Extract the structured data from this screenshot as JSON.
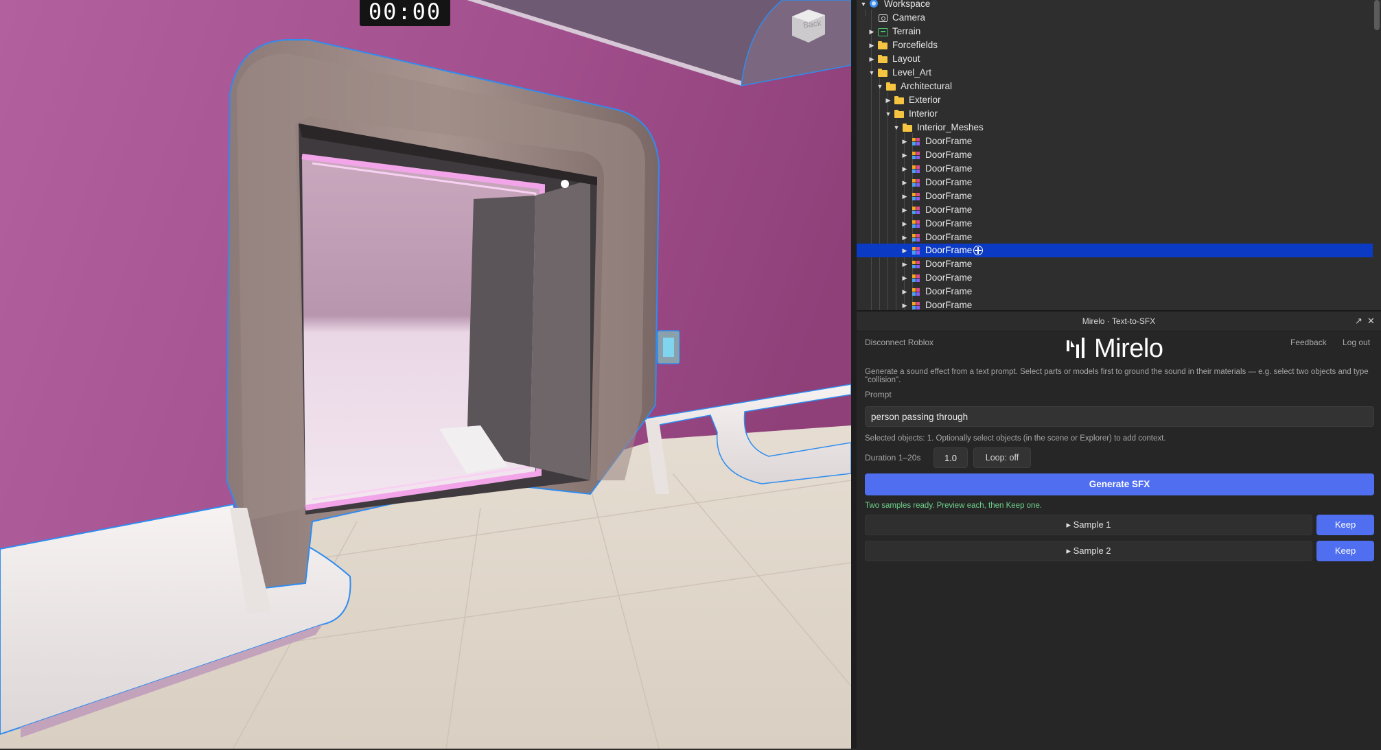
{
  "viewport": {
    "timer": "00:00",
    "view_cube_label": "Back"
  },
  "explorer": {
    "items": [
      {
        "label": "Workspace",
        "icon": "workspace-icon",
        "expanded": true
      },
      {
        "label": "Camera",
        "icon": "camera-icon"
      },
      {
        "label": "Terrain",
        "icon": "terrain-icon"
      },
      {
        "label": "Forcefields",
        "icon": "folder-icon",
        "expanded": false
      },
      {
        "label": "Layout",
        "icon": "folder-icon",
        "expanded": false
      },
      {
        "label": "Level_Art",
        "icon": "folder-icon",
        "expanded": true
      },
      {
        "label": "Architectural",
        "icon": "folder-icon",
        "expanded": true
      },
      {
        "label": "Exterior",
        "icon": "folder-icon",
        "expanded": false
      },
      {
        "label": "Interior",
        "icon": "folder-icon",
        "expanded": true
      },
      {
        "label": "Interior_Meshes",
        "icon": "folder-icon",
        "expanded": true
      },
      {
        "label": "DoorFrame",
        "icon": "model-icon",
        "expanded": false
      },
      {
        "label": "DoorFrame",
        "icon": "model-icon",
        "expanded": false
      },
      {
        "label": "DoorFrame",
        "icon": "model-icon",
        "expanded": false
      },
      {
        "label": "DoorFrame",
        "icon": "model-icon",
        "expanded": false
      },
      {
        "label": "DoorFrame",
        "icon": "model-icon",
        "expanded": false
      },
      {
        "label": "DoorFrame",
        "icon": "model-icon",
        "expanded": false
      },
      {
        "label": "DoorFrame",
        "icon": "model-icon",
        "expanded": false
      },
      {
        "label": "DoorFrame",
        "icon": "model-icon",
        "expanded": false
      },
      {
        "label": "DoorFrame",
        "icon": "model-icon",
        "expanded": false,
        "selected": true
      },
      {
        "label": "DoorFrame",
        "icon": "model-icon",
        "expanded": false
      },
      {
        "label": "DoorFrame",
        "icon": "model-icon",
        "expanded": false
      },
      {
        "label": "DoorFrame",
        "icon": "model-icon",
        "expanded": false
      },
      {
        "label": "DoorFrame",
        "icon": "model-icon",
        "expanded": false
      }
    ]
  },
  "plugin": {
    "title": "Mirelo · Text-to-SFX",
    "disconnect_label": "Disconnect Roblox",
    "feedback_label": "Feedback",
    "logout_label": "Log out",
    "logo_text": "Mirelo",
    "description": "Generate a sound effect from a text prompt. Select parts or models first to ground the sound in their materials — e.g. select two objects and type \"collision\".",
    "prompt_label": "Prompt",
    "prompt_value": "person passing through",
    "selected_objects": "Selected objects: 1. Optionally select objects (in the scene or Explorer) to add context.",
    "duration_label": "Duration 1–20s",
    "duration_value": "1.0",
    "loop_label": "Loop: off",
    "generate_label": "Generate SFX",
    "status": "Two samples ready. Preview each, then Keep one.",
    "samples": [
      {
        "label": "▸ Sample 1",
        "keep_label": "Keep"
      },
      {
        "label": "▸ Sample 2",
        "keep_label": "Keep"
      }
    ]
  },
  "colors": {
    "selection": "#0b3ac4",
    "accent": "#4f6ff0",
    "status": "#6ed08a",
    "wall": "#a3558f",
    "outline": "#2f8cf0"
  }
}
